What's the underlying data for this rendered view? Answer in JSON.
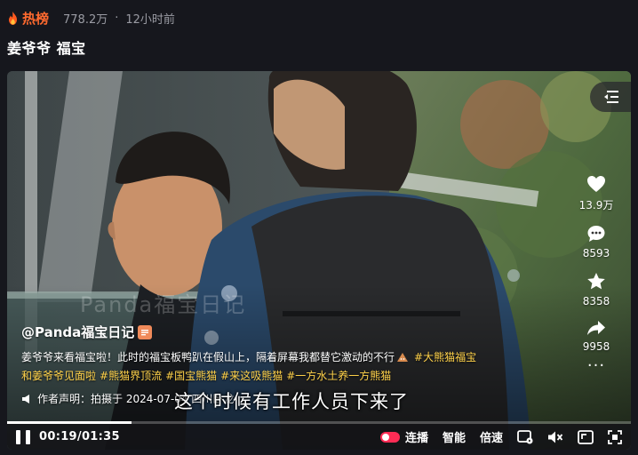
{
  "header": {
    "hot_label": "热榜",
    "views": "778.2万",
    "separator": "·",
    "time_ago": "12小时前"
  },
  "title": "姜爷爷 福宝",
  "video": {
    "watermark": "Panda福宝日记",
    "author": "@Panda福宝日记",
    "description": "姜爷爷来看福宝啦！此时的福宝板鸭趴在假山上，隔着屏幕我都替它激动的不行",
    "tags": [
      "#大熊猫福宝",
      "和姜爷爷见面啦",
      "#熊猫界顶流",
      "#国宝熊猫",
      "#来这吸熊猫",
      "#一方水土养一方熊猫"
    ],
    "declaration": "作者声明：拍摄于 2024-07-04 四川卧龙",
    "subtitle": "这个时候有工作人员下来了",
    "progress": 0.2
  },
  "actions": {
    "likes": "13.9万",
    "comments": "8593",
    "favorites": "8358",
    "shares": "9958",
    "more": "···"
  },
  "controls": {
    "current_time": "00:19",
    "duration": "01:35",
    "time_sep": "/",
    "autoplay_label": "连播",
    "quality_label": "智能",
    "speed_label": "倍速"
  },
  "colors": {
    "accent": "#fe2c55",
    "hot": "#ff6a2f",
    "tag": "#ffd24a"
  }
}
